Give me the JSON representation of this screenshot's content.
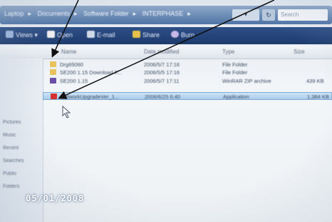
{
  "address_bar": {
    "crumbs": [
      "Laptop",
      "Documents",
      "Software Folder",
      "INTERPHASE"
    ],
    "dropdown_label": "▾",
    "refresh_label": "↻",
    "search_placeholder": "Search"
  },
  "toolbar": {
    "views_label": "Views",
    "open_label": "Open",
    "email_label": "E-mail",
    "share_label": "Share",
    "burn_label": "Burn"
  },
  "columns": [
    "Name",
    "Date modified",
    "Type",
    "Size"
  ],
  "nav_pane": {
    "items": [
      "Pictures",
      "Music",
      "Recent",
      "Searches",
      "Public",
      "Folders"
    ]
  },
  "files": [
    {
      "name": "Drg65060",
      "date": "2006/5/7 17:16",
      "type": "File Folder",
      "size": "",
      "icon_color": "#e8c25a"
    },
    {
      "name": "SE200 1.15 Download F...",
      "date": "2006/5/5 17:16",
      "type": "File Folder",
      "size": "",
      "icon_color": "#e8c25a"
    },
    {
      "name": "SE200 1.15",
      "date": "2006/5/7 17:11",
      "type": "WinRAR ZIP archive",
      "size": "439 KB",
      "icon_color": "#6b4fa8"
    },
    {
      "name": "NetworkUpgradeVer_1...",
      "date": "2006/6/25 6:40",
      "type": "Application",
      "size": "1,384 KB",
      "icon_color": "#d43030"
    }
  ],
  "selected_index": 3,
  "photo_timestamp": "05/01/2008",
  "colors": {
    "toolbar": "#1d3a6d",
    "selection": "#a9cbe9",
    "arrow": "#111111"
  }
}
